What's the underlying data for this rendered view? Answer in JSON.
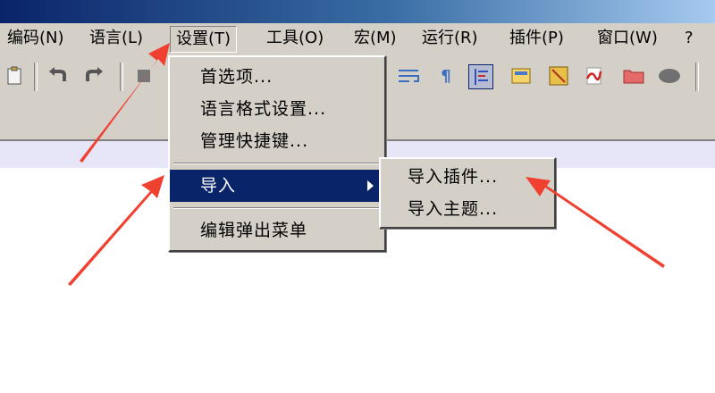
{
  "menubar": {
    "items": [
      {
        "label": "编码(N)"
      },
      {
        "label": "语言(L)"
      },
      {
        "label": "设置(T)"
      },
      {
        "label": "工具(O)"
      },
      {
        "label": "宏(M)"
      },
      {
        "label": "运行(R)"
      },
      {
        "label": "插件(P)"
      },
      {
        "label": "窗口(W)"
      },
      {
        "label": "?"
      }
    ]
  },
  "settings_menu": {
    "items": [
      {
        "label": "首选项..."
      },
      {
        "label": "语言格式设置..."
      },
      {
        "label": "管理快捷键..."
      },
      {
        "label": "导入"
      },
      {
        "label": "编辑弹出菜单"
      }
    ]
  },
  "import_submenu": {
    "items": [
      {
        "label": "导入插件..."
      },
      {
        "label": "导入主题..."
      }
    ]
  },
  "toolbar": {
    "icons": [
      "paste-icon",
      "undo-icon",
      "redo-icon",
      "wrap-icon",
      "pilcrow-icon",
      "indent-guide-icon",
      "doc-map-icon",
      "function-list-icon",
      "folder-workspace-icon",
      "folder-icon",
      "record-macro-icon"
    ]
  },
  "colors": {
    "annotation_arrow": "#f04030",
    "highlight": "#0a246a",
    "chrome": "#d4d0c8"
  }
}
